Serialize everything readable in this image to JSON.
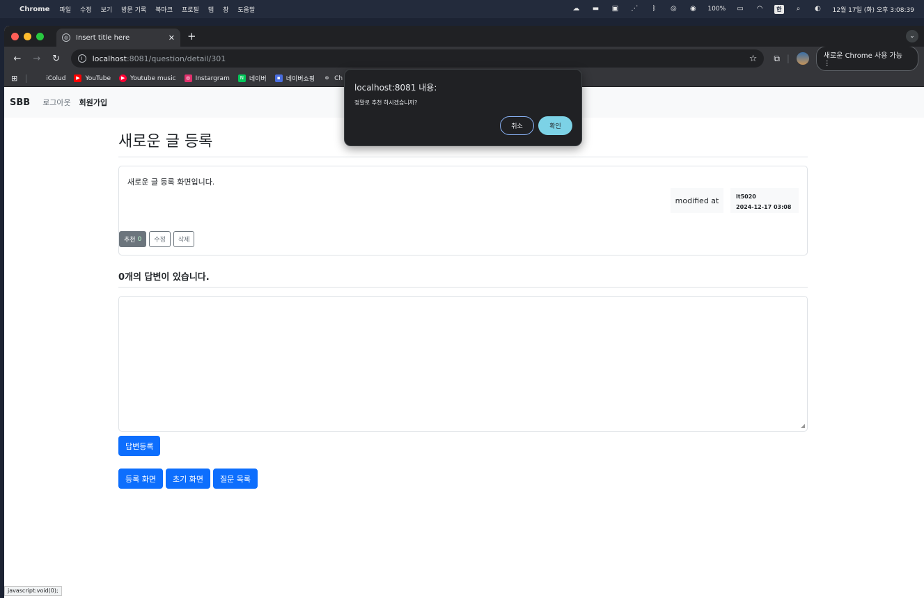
{
  "menubar": {
    "app": "Chrome",
    "items": [
      "파일",
      "수정",
      "보기",
      "방문 기록",
      "북마크",
      "프로필",
      "탭",
      "창",
      "도움말"
    ],
    "battery": "100%",
    "input_method": "한",
    "datetime": "12월 17일 (화) 오후 3:08:39"
  },
  "browser": {
    "tab_title": "Insert title here",
    "url_host": "localhost",
    "url_path": ":8081/question/detail/301",
    "chrome_badge": "새로운 Chrome 사용 가능",
    "bookmarks": [
      {
        "label": "iColud",
        "color": "#9aa0a6"
      },
      {
        "label": "YouTube",
        "color": "#ff0000"
      },
      {
        "label": "Youtube music",
        "color": "#ff0033"
      },
      {
        "label": "Instargram",
        "color": "#e1306c"
      },
      {
        "label": "네이버",
        "color": "#03c75a"
      },
      {
        "label": "네이버쇼핑",
        "color": "#4a6ee0"
      },
      {
        "label": "Ch",
        "color": "#9aa0a6"
      }
    ],
    "status_text": "javascript:void(0);"
  },
  "navbar": {
    "brand": "SBB",
    "links": [
      "로그아웃",
      "회원가입"
    ]
  },
  "question": {
    "title": "새로운 글 등록",
    "content": "새로운 글 등록 화면입니다.",
    "modified_label": "modified at",
    "author": "lt5020",
    "date": "2024-12-17 03:08",
    "recommend_label": "추천",
    "recommend_count": "0",
    "edit_label": "수정",
    "delete_label": "삭제"
  },
  "answers": {
    "heading": "0개의 답변이 있습니다.",
    "submit_label": "답변등록"
  },
  "actions": [
    "등록 화면",
    "초기 화면",
    "질문 목록"
  ],
  "dialog": {
    "title": "localhost:8081 내용:",
    "message": "정말로 추천 하시겠습니까?",
    "cancel_label": "취소",
    "ok_label": "확인"
  }
}
